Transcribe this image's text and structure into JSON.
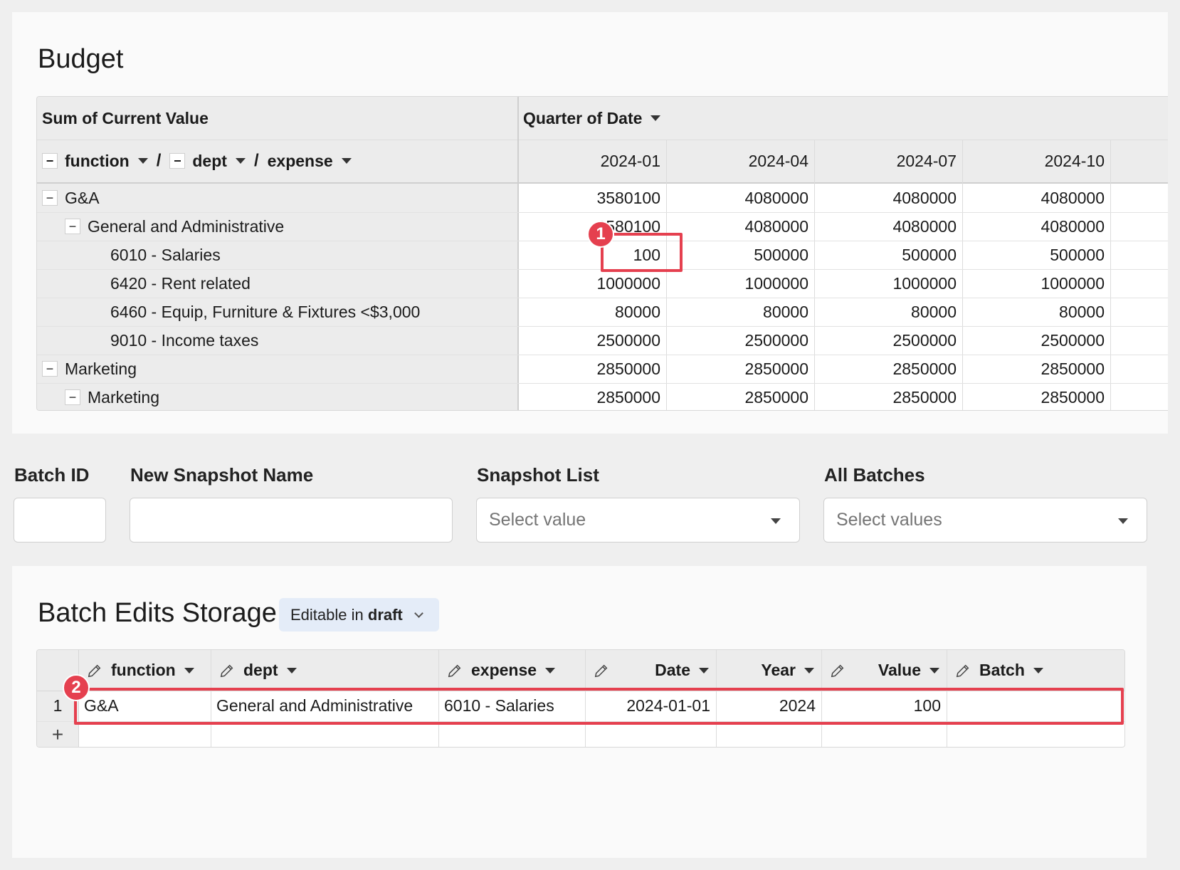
{
  "budget": {
    "title": "Budget",
    "corner_label": "Sum of Current Value",
    "column_group_label": "Quarter of Date",
    "row_headers": [
      "function",
      "dept",
      "expense"
    ],
    "separator": "/",
    "quarters": [
      "2024-01",
      "2024-04",
      "2024-07",
      "2024-10"
    ],
    "rows": [
      {
        "label": "G&A",
        "values": [
          "3580100",
          "4080000",
          "4080000",
          "4080000"
        ]
      },
      {
        "label": "General and Administrative",
        "values": [
          "3580100",
          "4080000",
          "4080000",
          "4080000"
        ]
      },
      {
        "label": "6010 - Salaries",
        "values": [
          "100",
          "500000",
          "500000",
          "500000"
        ]
      },
      {
        "label": "6420 - Rent related",
        "values": [
          "1000000",
          "1000000",
          "1000000",
          "1000000"
        ]
      },
      {
        "label": "6460 - Equip, Furniture & Fixtures <$3,000",
        "values": [
          "80000",
          "80000",
          "80000",
          "80000"
        ]
      },
      {
        "label": "9010 - Income taxes",
        "values": [
          "2500000",
          "2500000",
          "2500000",
          "2500000"
        ]
      },
      {
        "label": "Marketing",
        "values": [
          "2850000",
          "2850000",
          "2850000",
          "2850000"
        ]
      },
      {
        "label": "Marketing",
        "values": [
          "2850000",
          "2850000",
          "2850000",
          "2850000"
        ]
      }
    ]
  },
  "controls": {
    "batch_id_label": "Batch ID",
    "snapshot_name_label": "New Snapshot Name",
    "snapshot_list_label": "Snapshot List",
    "snapshot_list_placeholder": "Select value",
    "all_batches_label": "All Batches",
    "all_batches_placeholder": "Select values"
  },
  "batch": {
    "title": "Batch Edits Storage",
    "badge_prefix": "Editable in",
    "badge_strong": "draft",
    "columns": [
      "function",
      "dept",
      "expense",
      "Date",
      "Year",
      "Value",
      "Batch"
    ],
    "rows": [
      {
        "num": "1",
        "function": "G&A",
        "dept": "General and Administrative",
        "expense": "6010 - Salaries",
        "date": "2024-01-01",
        "year": "2024",
        "value": "100",
        "batch": ""
      }
    ],
    "add_row": "+"
  },
  "callouts": [
    "1",
    "2"
  ],
  "colors": {
    "callout": "#e5404f",
    "badge_bg": "#e4ecf8"
  }
}
